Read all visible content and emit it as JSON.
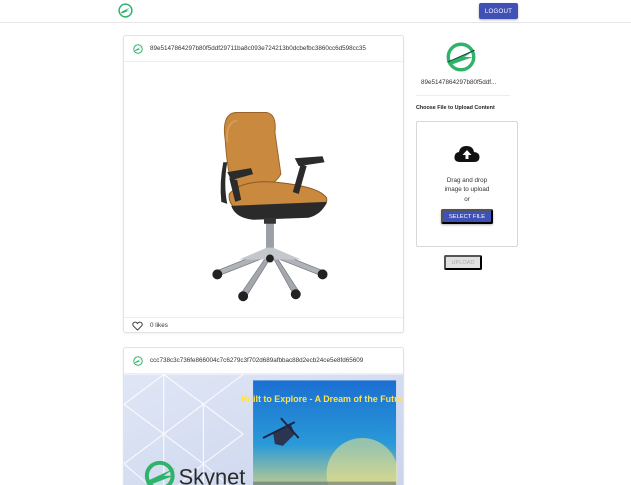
{
  "header": {
    "logo_icon": "skynet-logo-icon",
    "logout_label": "LOGOUT",
    "accent_color": "#3f51b5"
  },
  "feed": {
    "posts": [
      {
        "hash": "89e5147864297b80f5ddf29711ba8c093e724213b0dcbefbc3860cc6d598cc35",
        "image": "office-chair-photo",
        "likes_label": "0 likes",
        "like_icon": "heart-outline-icon"
      },
      {
        "hash": "ccc738c3c736fe866004c7c6279c3f702d689afbbac88d2ecb24ce5e8fd65609",
        "image": "skynet-poster",
        "poster_title": "Built to Explore - A Dream of the Future",
        "poster_brand": "Skynet"
      }
    ]
  },
  "sidebar": {
    "profile_hash": "89e5147864297b80f5ddf...",
    "choose_title": "Choose File to Upload Content",
    "dropzone": {
      "icon": "cloud-upload-icon",
      "text_line1": "Drag and drop",
      "text_line2": "image to upload",
      "or_label": "or",
      "select_label": "SELECT FILE"
    },
    "upload_label": "UPLOAD"
  }
}
